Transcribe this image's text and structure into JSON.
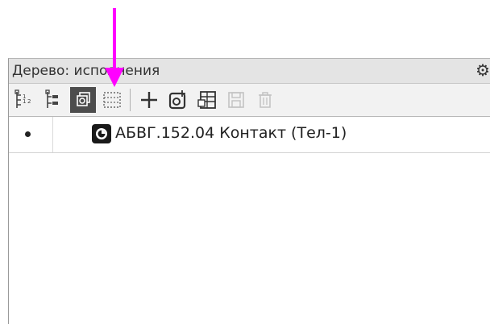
{
  "panel": {
    "title": "Дерево: исполнения",
    "settings_icon": "gear-icon"
  },
  "toolbar": {
    "buttons": [
      {
        "name": "structure-tree-icon",
        "state": "normal"
      },
      {
        "name": "list-tree-icon",
        "state": "normal"
      },
      {
        "name": "variants-icon",
        "state": "active"
      },
      {
        "name": "dotted-select-icon",
        "state": "normal"
      },
      {
        "name": "add-icon",
        "state": "normal"
      },
      {
        "name": "refresh-part-icon",
        "state": "normal"
      },
      {
        "name": "table-icon",
        "state": "normal"
      },
      {
        "name": "save-icon",
        "state": "disabled"
      },
      {
        "name": "delete-icon",
        "state": "disabled"
      }
    ]
  },
  "tree": {
    "rows": [
      {
        "marker": "•",
        "icon": "part-icon",
        "label": "АБВГ.152.04 Контакт (Тел-1)"
      }
    ]
  },
  "annotation": {
    "arrow_color": "#ff00ff"
  }
}
